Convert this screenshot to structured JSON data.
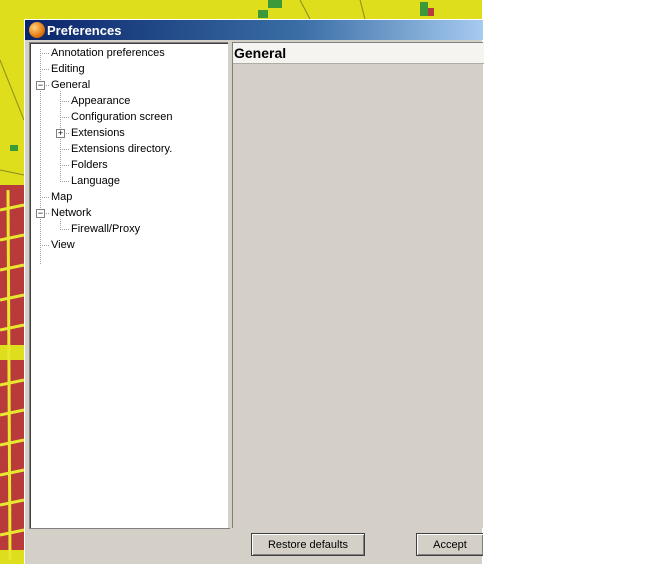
{
  "window": {
    "title": "Preferences"
  },
  "tree": {
    "items": [
      {
        "label": "Annotation preferences"
      },
      {
        "label": "Editing"
      },
      {
        "label": "General",
        "expanded": true
      },
      {
        "label": "Appearance"
      },
      {
        "label": "Configuration screen"
      },
      {
        "label": "Extensions",
        "expanded": false
      },
      {
        "label": "Extensions directory."
      },
      {
        "label": "Folders"
      },
      {
        "label": "Language"
      },
      {
        "label": "Map"
      },
      {
        "label": "Network",
        "expanded": true
      },
      {
        "label": "Firewall/Proxy"
      },
      {
        "label": "View"
      }
    ],
    "expand_glyph": "+",
    "collapse_glyph": "−"
  },
  "content": {
    "title": "General"
  },
  "buttons": {
    "restore_label": "Restore defaults",
    "accept_label": "Accept"
  },
  "colors": {
    "map_background": "#dede1c",
    "map_blocks": "#b83a3a",
    "titlebar_start": "#0a246a",
    "dialog_face": "#d4d0c8"
  },
  "icons": {
    "app": "app-globe-icon",
    "expander_expanded": "minus-box-icon",
    "expander_collapsed": "plus-box-icon"
  }
}
